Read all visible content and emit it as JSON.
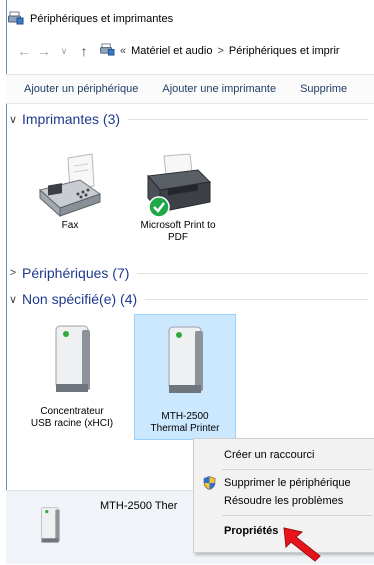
{
  "window": {
    "title": "Périphériques et imprimantes"
  },
  "address": {
    "overflow": "«",
    "crumbs": [
      "Matériel et audio",
      "Périphériques et imprir"
    ],
    "separator": ">"
  },
  "commands": [
    "Ajouter un périphérique",
    "Ajouter une imprimante",
    "Supprime"
  ],
  "groups": {
    "printers": {
      "label": "Imprimantes (3)",
      "chevron": "∨"
    },
    "devices": {
      "label": "Périphériques (7)",
      "chevron": ">"
    },
    "unspecified": {
      "label": "Non spécifié(e) (4)",
      "chevron": "∨"
    }
  },
  "printers": [
    {
      "line1": "Fax",
      "line2": ""
    },
    {
      "line1": "Microsoft Print to",
      "line2": "PDF"
    }
  ],
  "unspecified": [
    {
      "line1": "Concentrateur",
      "line2": "USB racine (xHCI)"
    },
    {
      "line1": "MTH-2500",
      "line2": "Thermal Printer"
    }
  ],
  "context_menu": {
    "create_shortcut": "Créer un raccourci",
    "remove_device": "Supprimer le périphérique",
    "troubleshoot": "Résoudre les problèmes",
    "properties": "Propriétés"
  },
  "details": {
    "name": "MTH-2500 Ther"
  },
  "colors": {
    "group_header": "#1e3a8c",
    "selection": "#cce8ff",
    "default_check": "#1fa84a",
    "arrow": "#e8141c"
  }
}
